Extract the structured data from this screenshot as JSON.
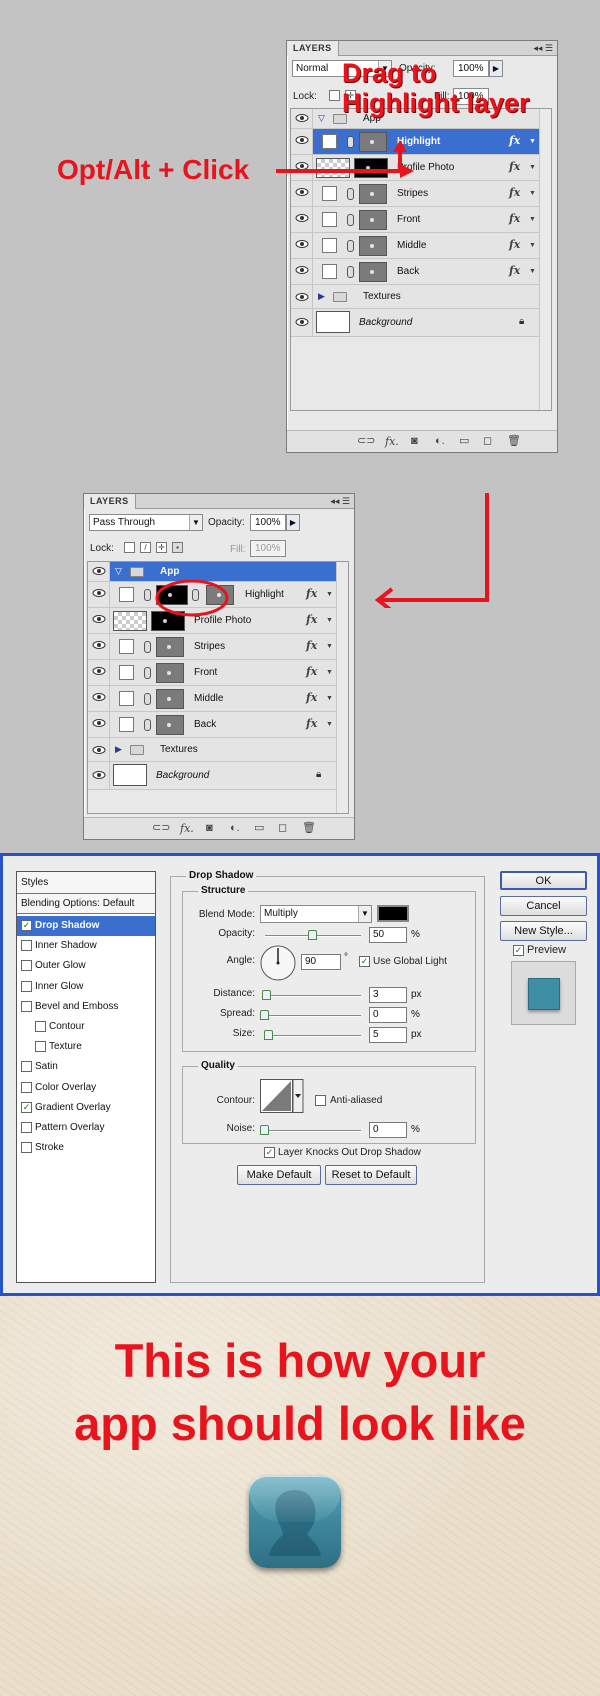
{
  "panel1": {
    "tab": "LAYERS",
    "blend_mode": "Normal",
    "opacity_label": "Opacity:",
    "opacity": "100%",
    "lock_label": "Lock:",
    "fill_label": "Fill:",
    "fill": "100%",
    "group_name": "App",
    "layers": [
      {
        "name": "Highlight",
        "thumb": "gray",
        "active": true
      },
      {
        "name": "Profile Photo",
        "thumb": "check"
      },
      {
        "name": "Stripes",
        "thumb": "gray"
      },
      {
        "name": "Front",
        "thumb": "gray"
      },
      {
        "name": "Middle",
        "thumb": "gray"
      },
      {
        "name": "Back",
        "thumb": "gray"
      }
    ],
    "textures": "Textures",
    "background": "Background"
  },
  "annotations": {
    "drag": "Drag to Highlight layer",
    "drag_line1": "Drag to",
    "drag_line2": "Highlight layer",
    "optalt": "Opt/Alt + Click"
  },
  "panel2": {
    "tab": "LAYERS",
    "blend_mode": "Pass Through",
    "opacity_label": "Opacity:",
    "opacity": "100%",
    "lock_label": "Lock:",
    "fill_label": "Fill:",
    "fill": "100%",
    "group_name": "App",
    "layers": [
      {
        "name": "Highlight",
        "thumb": "gray"
      },
      {
        "name": "Profile Photo",
        "thumb": "check"
      },
      {
        "name": "Stripes",
        "thumb": "gray"
      },
      {
        "name": "Front",
        "thumb": "gray"
      },
      {
        "name": "Middle",
        "thumb": "gray"
      },
      {
        "name": "Back",
        "thumb": "gray"
      }
    ],
    "textures": "Textures",
    "background": "Background"
  },
  "fx": "fx",
  "dialog": {
    "styles": [
      {
        "label": "Styles",
        "kind": "head"
      },
      {
        "label": "Blending Options: Default",
        "kind": "head"
      },
      {
        "label": "Drop Shadow",
        "checked": true,
        "selected": true
      },
      {
        "label": "Inner Shadow",
        "checked": false
      },
      {
        "label": "Outer Glow",
        "checked": false
      },
      {
        "label": "Inner Glow",
        "checked": false
      },
      {
        "label": "Bevel and Emboss",
        "checked": false
      },
      {
        "label": "Contour",
        "checked": false,
        "indent": true
      },
      {
        "label": "Texture",
        "checked": false,
        "indent": true
      },
      {
        "label": "Satin",
        "checked": false
      },
      {
        "label": "Color Overlay",
        "checked": false
      },
      {
        "label": "Gradient Overlay",
        "checked": true
      },
      {
        "label": "Pattern Overlay",
        "checked": false
      },
      {
        "label": "Stroke",
        "checked": false
      }
    ],
    "section_title": "Drop Shadow",
    "structure_title": "Structure",
    "blend_mode_label": "Blend Mode:",
    "blend_mode": "Multiply",
    "opacity_label": "Opacity:",
    "opacity": "50",
    "opacity_unit": "%",
    "angle_label": "Angle:",
    "angle": "90",
    "angle_unit": "°",
    "global_light": "Use Global Light",
    "distance_label": "Distance:",
    "distance": "3",
    "distance_unit": "px",
    "spread_label": "Spread:",
    "spread": "0",
    "spread_unit": "%",
    "size_label": "Size:",
    "size": "5",
    "size_unit": "px",
    "quality_title": "Quality",
    "contour_label": "Contour:",
    "anti_aliased": "Anti-aliased",
    "noise_label": "Noise:",
    "noise": "0",
    "noise_unit": "%",
    "knockout": "Layer Knocks Out Drop Shadow",
    "make_default": "Make Default",
    "reset_default": "Reset to Default",
    "ok": "OK",
    "cancel": "Cancel",
    "new_style": "New Style...",
    "preview": "Preview",
    "preview_color": "#3e8fa3"
  },
  "bottom": {
    "line1": "This is how your",
    "line2": "app should look like",
    "icon_color": "#4a97ad"
  }
}
